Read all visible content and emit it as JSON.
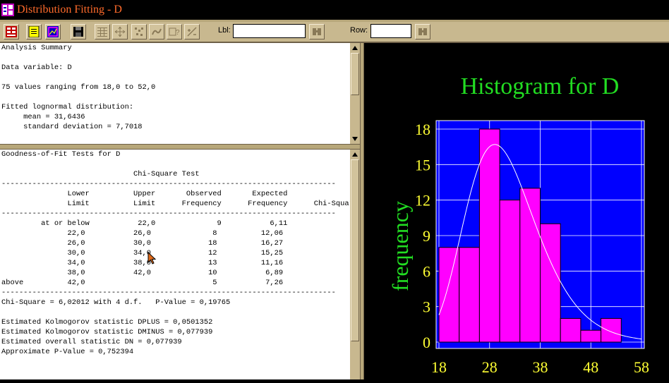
{
  "window": {
    "title": "Distribution Fitting - D"
  },
  "toolbar": {
    "lbl_label": "Lbl:",
    "lbl_value": "",
    "row_label": "Row:",
    "row_value": ""
  },
  "summary": {
    "lines": [
      "Analysis Summary",
      "",
      "Data variable: D",
      "",
      "75 values ranging from 18,0 to 52,0",
      "",
      "Fitted lognormal distribution:",
      "     mean = 31,6436",
      "     standard deviation = 7,7018"
    ]
  },
  "gof": {
    "lines": [
      "Goodness-of-Fit Tests for D",
      "",
      "                              Chi-Square Test",
      "----------------------------------------------------------------------------",
      "               Lower          Upper       Observed       Expected",
      "               Limit          Limit      Frequency      Frequency      Chi-Square",
      "----------------------------------------------------------------------------",
      "         at or below           22,0              9           6,11",
      "               22,0           26,0              8          12,06",
      "               26,0           30,0             18          16,27",
      "               30,0           34,0             12          15,25",
      "               34,0           38,0             13          11,16",
      "               38,0           42,0             10           6,89",
      "above          42,0                             5           7,26",
      "----------------------------------------------------------------------------",
      "Chi-Square = 6,02012 with 4 d.f.   P-Value = 0,19765",
      "",
      "Estimated Kolmogorov statistic DPLUS = 0,0501352",
      "Estimated Kolmogorov statistic DMINUS = 0,077939",
      "Estimated overall statistic DN = 0,077939",
      "Approximate P-Value = 0,752394"
    ]
  },
  "colors": {
    "title_text": "#ff6b2b",
    "chart_title": "#22dd22",
    "axis_text": "#ffff33",
    "plot_bg": "#0000ff",
    "bar_fill": "#ff00ff",
    "curve": "#ffffff"
  },
  "icons": [
    "statgraphics-icon",
    "input-dialog-icon",
    "text-options-icon",
    "graph-options-icon",
    "save-icon",
    "tables-icon",
    "graphs-icon",
    "excluded-points-icon",
    "pan-icon",
    "identify-icon",
    "smooth-icon",
    "locate-icon",
    "find-row-icon"
  ],
  "chart_data": {
    "type": "bar",
    "title": "Histogram for D",
    "xlabel": "",
    "ylabel": "frequency",
    "bin_edges": [
      18,
      22,
      26,
      30,
      34,
      38,
      42,
      46,
      50,
      54
    ],
    "values": [
      8,
      8,
      18,
      12,
      13,
      10,
      2,
      1,
      2
    ],
    "xlim": [
      18,
      58
    ],
    "ylim": [
      0,
      18
    ],
    "xticks": [
      18,
      28,
      38,
      48,
      58
    ],
    "yticks": [
      0,
      3,
      6,
      9,
      12,
      15,
      18
    ],
    "fitted_curve": {
      "distribution": "lognormal",
      "mean": 31.6436,
      "sd": 7.7018,
      "n": 75,
      "bin_width": 4
    },
    "grid": true,
    "legend": "none"
  }
}
